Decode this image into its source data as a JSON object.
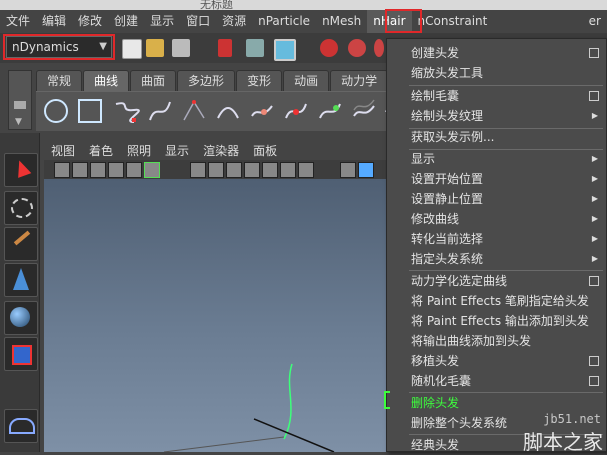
{
  "window": {
    "title": "无标题"
  },
  "menubar": {
    "items": [
      "文件",
      "编辑",
      "修改",
      "创建",
      "显示",
      "窗口",
      "资源",
      "nParticle",
      "nMesh",
      "nHair",
      "nConstraint"
    ],
    "overflow": "er"
  },
  "toolbar": {
    "mode": "nDynamics"
  },
  "shelf": {
    "tabs": [
      "常规",
      "曲线",
      "曲面",
      "多边形",
      "变形",
      "动画",
      "动力学"
    ],
    "active_tab": "曲线"
  },
  "panel": {
    "menus": [
      "视图",
      "着色",
      "照明",
      "显示",
      "渲染器",
      "面板"
    ]
  },
  "dropdown": {
    "items": [
      {
        "label": "创建头发",
        "opt": true
      },
      {
        "label": "缩放头发工具"
      },
      {
        "label": "绘制毛囊",
        "opt": true
      },
      {
        "label": "绘制头发纹理",
        "sub": true
      },
      {
        "label": "获取头发示例..."
      },
      {
        "label": "显示",
        "sub": true
      },
      {
        "label": "设置开始位置",
        "sub": true
      },
      {
        "label": "设置静止位置",
        "sub": true
      },
      {
        "label": "修改曲线",
        "sub": true
      },
      {
        "label": "转化当前选择",
        "sub": true
      },
      {
        "label": "指定头发系统",
        "sub": true
      },
      {
        "label": "动力学化选定曲线",
        "opt": true
      },
      {
        "label": "将 Paint Effects 笔刷指定给头发"
      },
      {
        "label": "将 Paint Effects 输出添加到头发"
      },
      {
        "label": "将输出曲线添加到头发"
      },
      {
        "label": "移植头发",
        "opt": true
      },
      {
        "label": "随机化毛囊",
        "opt": true
      },
      {
        "label": "删除头发",
        "highlight": true
      },
      {
        "label": "删除整个头发系统"
      },
      {
        "label": "经典头发"
      }
    ],
    "highlight_color": "#3dff3d"
  },
  "watermark": {
    "url": "jb51.net",
    "site": "脚本之家"
  },
  "colors": {
    "annotation": "#e0282a",
    "menu_bg": "#4b4b4b"
  }
}
